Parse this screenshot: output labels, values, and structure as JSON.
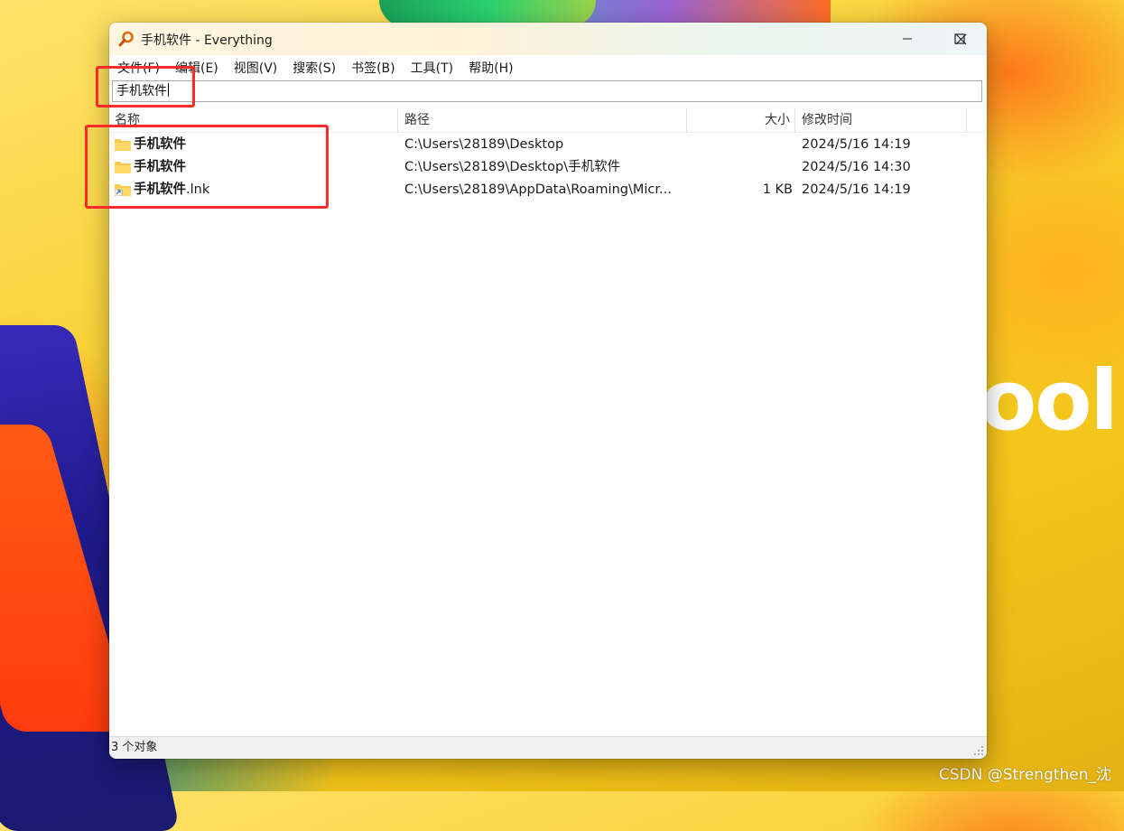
{
  "window": {
    "title": "手机软件 - Everything",
    "controls": {
      "minimize": "minimize-icon",
      "maximize": "maximize-icon",
      "close": "close-icon"
    }
  },
  "menu": [
    {
      "label": "文件(F)"
    },
    {
      "label": "编辑(E)"
    },
    {
      "label": "视图(V)"
    },
    {
      "label": "搜索(S)"
    },
    {
      "label": "书签(B)"
    },
    {
      "label": "工具(T)"
    },
    {
      "label": "帮助(H)"
    }
  ],
  "search": {
    "value": "手机软件"
  },
  "columns": {
    "name": "名称",
    "path": "路径",
    "size": "大小",
    "modified": "修改时间"
  },
  "rows": [
    {
      "name": "手机软件",
      "ext": "",
      "icon": "folder-icon",
      "path": "C:\\Users\\28189\\Desktop",
      "size": "",
      "modified": "2024/5/16 14:19"
    },
    {
      "name": "手机软件",
      "ext": "",
      "icon": "folder-icon",
      "path": "C:\\Users\\28189\\Desktop\\手机软件",
      "size": "",
      "modified": "2024/5/16 14:30"
    },
    {
      "name": "手机软件",
      "ext": ".lnk",
      "icon": "shortcut-icon",
      "path": "C:\\Users\\28189\\AppData\\Roaming\\Micr...",
      "size": "1 KB",
      "modified": "2024/5/16 14:19"
    }
  ],
  "status": {
    "text": "3 个对象"
  },
  "wallpaper": {
    "text": "ool"
  },
  "watermark": "CSDN @Strengthen_沈",
  "colors": {
    "annotation": "#ff2a2a",
    "folder": "#f8c94a"
  }
}
